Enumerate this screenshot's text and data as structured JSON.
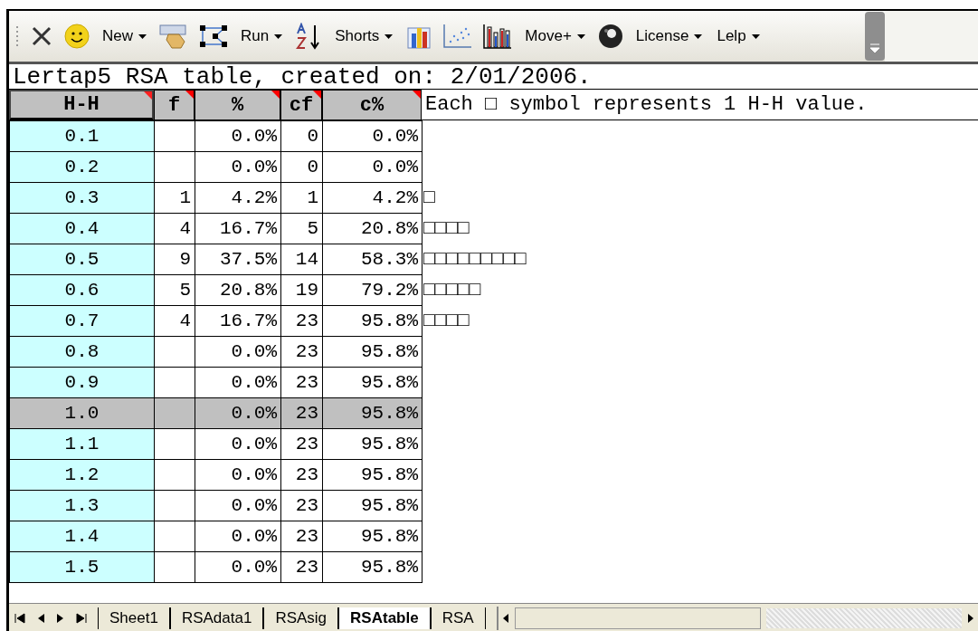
{
  "toolbar": {
    "menus": [
      {
        "label": "New"
      },
      {
        "label": "Run"
      },
      {
        "label": "Shorts"
      },
      {
        "label": "Move+"
      },
      {
        "label": "License"
      },
      {
        "label": "Lelp"
      }
    ]
  },
  "sheet": {
    "title": "Lertap5 RSA table, created on: 2/01/2006.",
    "columns": [
      "H-H",
      "f",
      "%",
      "cf",
      "c%"
    ],
    "legend": "Each □ symbol represents 1 H-H value.",
    "rows": [
      {
        "hh": "0.1",
        "pct": "0.0%",
        "cf": "0",
        "cpct": "0.0%",
        "highlighted": false
      },
      {
        "hh": "0.2",
        "pct": "0.0%",
        "cf": "0",
        "cpct": "0.0%",
        "highlighted": false
      },
      {
        "hh": "0.3",
        "f": "1",
        "pct": "4.2%",
        "cf": "1",
        "cpct": "4.2%",
        "bar": "□",
        "highlighted": false
      },
      {
        "hh": "0.4",
        "f": "4",
        "pct": "16.7%",
        "cf": "5",
        "cpct": "20.8%",
        "bar": "□□□□",
        "highlighted": false
      },
      {
        "hh": "0.5",
        "f": "9",
        "pct": "37.5%",
        "cf": "14",
        "cpct": "58.3%",
        "bar": "□□□□□□□□□",
        "highlighted": false
      },
      {
        "hh": "0.6",
        "f": "5",
        "pct": "20.8%",
        "cf": "19",
        "cpct": "79.2%",
        "bar": "□□□□□",
        "highlighted": false
      },
      {
        "hh": "0.7",
        "f": "4",
        "pct": "16.7%",
        "cf": "23",
        "cpct": "95.8%",
        "bar": "□□□□",
        "highlighted": false
      },
      {
        "hh": "0.8",
        "pct": "0.0%",
        "cf": "23",
        "cpct": "95.8%",
        "highlighted": false
      },
      {
        "hh": "0.9",
        "pct": "0.0%",
        "cf": "23",
        "cpct": "95.8%",
        "highlighted": false
      },
      {
        "hh": "1.0",
        "pct": "0.0%",
        "cf": "23",
        "cpct": "95.8%",
        "highlighted": true
      },
      {
        "hh": "1.1",
        "pct": "0.0%",
        "cf": "23",
        "cpct": "95.8%",
        "highlighted": false
      },
      {
        "hh": "1.2",
        "pct": "0.0%",
        "cf": "23",
        "cpct": "95.8%",
        "highlighted": false
      },
      {
        "hh": "1.3",
        "pct": "0.0%",
        "cf": "23",
        "cpct": "95.8%",
        "highlighted": false
      },
      {
        "hh": "1.4",
        "pct": "0.0%",
        "cf": "23",
        "cpct": "95.8%",
        "highlighted": false
      },
      {
        "hh": "1.5",
        "pct": "0.0%",
        "cf": "23",
        "cpct": "95.8%",
        "highlighted": false
      }
    ]
  },
  "sheet_tabs": [
    {
      "label": "Sheet1",
      "selected": false
    },
    {
      "label": "RSAdata1",
      "selected": false
    },
    {
      "label": "RSAsig",
      "selected": false
    },
    {
      "label": "RSAtable",
      "selected": true
    },
    {
      "label": "RSA",
      "selected": false
    }
  ]
}
